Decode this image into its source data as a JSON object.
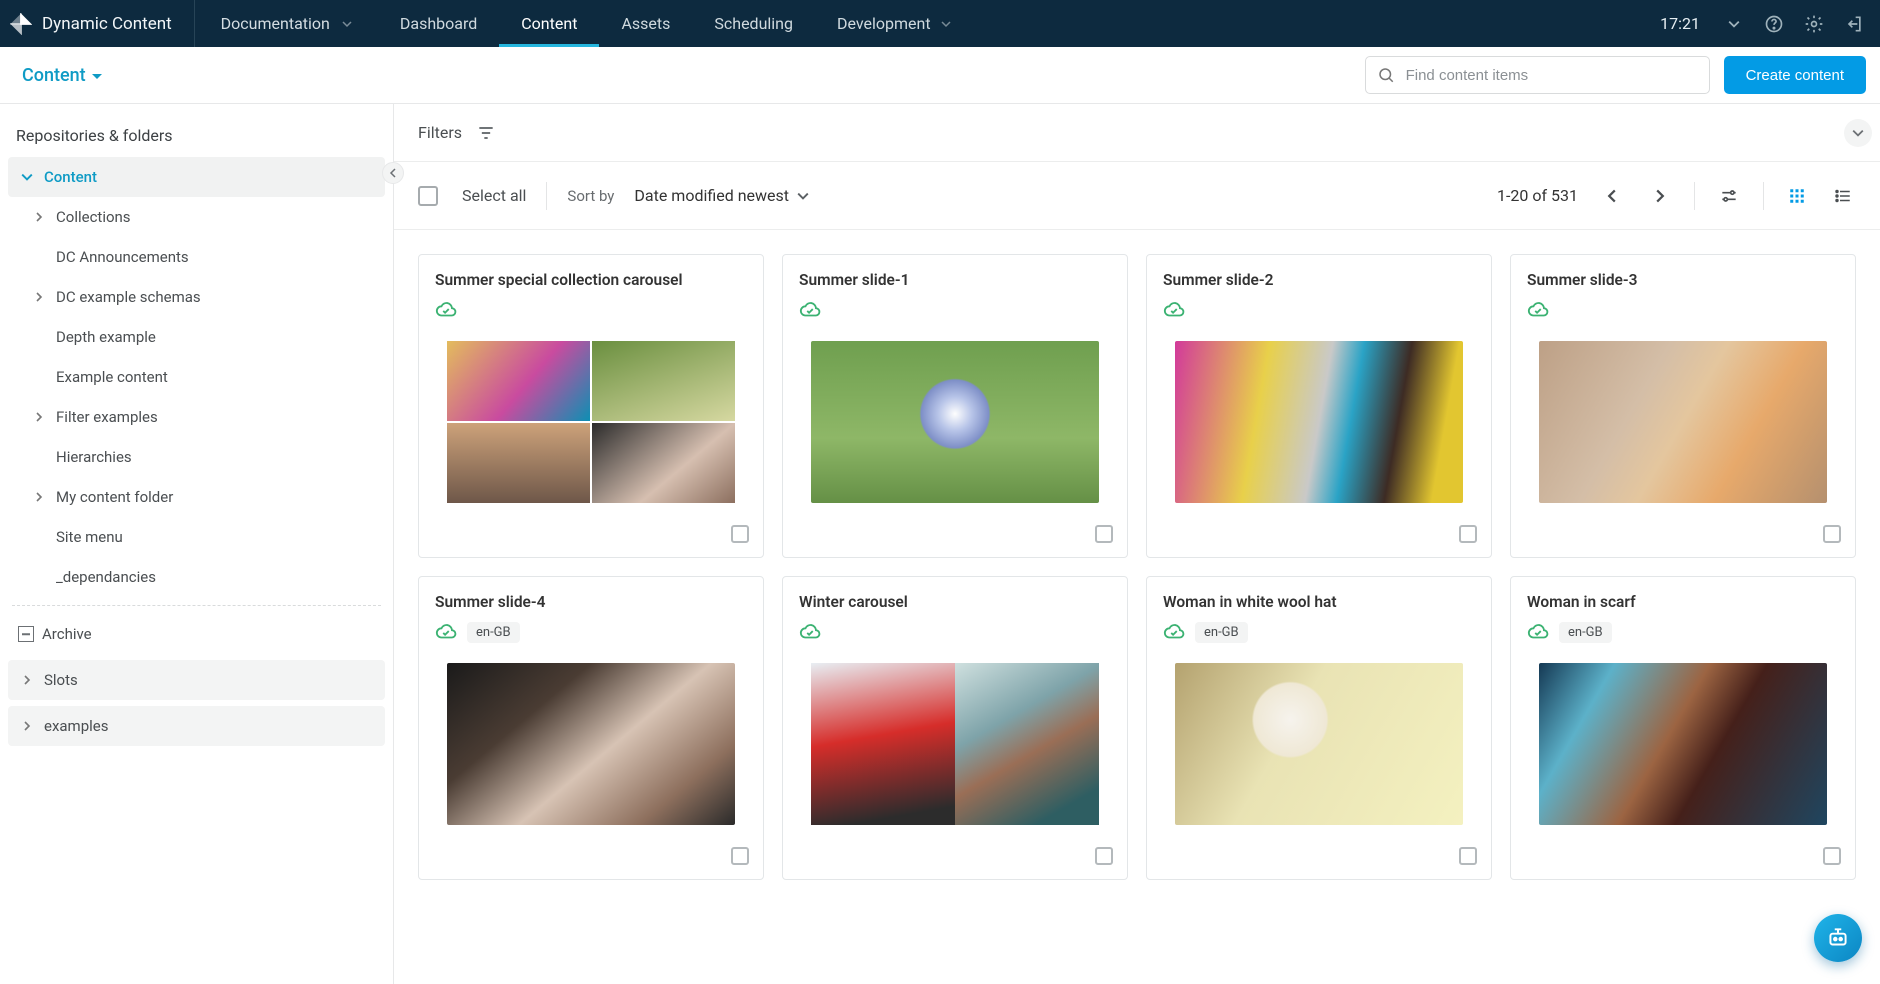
{
  "brand": {
    "name": "Dynamic Content"
  },
  "topnav": {
    "documentation": "Documentation",
    "items": [
      "Dashboard",
      "Content",
      "Assets",
      "Scheduling",
      "Development"
    ],
    "active": "Content",
    "time": "17:21"
  },
  "subbar": {
    "title": "Content",
    "search_placeholder": "Find content items",
    "create_label": "Create content"
  },
  "sidebar": {
    "title": "Repositories & folders",
    "root_label": "Content",
    "children": [
      {
        "label": "Collections",
        "expandable": true
      },
      {
        "label": "DC Announcements",
        "expandable": false
      },
      {
        "label": "DC example schemas",
        "expandable": true
      },
      {
        "label": "Depth example",
        "expandable": false
      },
      {
        "label": "Example content",
        "expandable": false
      },
      {
        "label": "Filter examples",
        "expandable": true
      },
      {
        "label": "Hierarchies",
        "expandable": false
      },
      {
        "label": "My content folder",
        "expandable": true
      },
      {
        "label": "Site menu",
        "expandable": false
      },
      {
        "label": "_dependancies",
        "expandable": false
      }
    ],
    "archive": "Archive",
    "repos": [
      {
        "label": "Slots"
      },
      {
        "label": "examples"
      }
    ]
  },
  "main": {
    "filters_label": "Filters",
    "select_all": "Select all",
    "sort_by_label": "Sort by",
    "sort_by_value": "Date modified newest",
    "pagination": "1-20 of 531",
    "cards": [
      {
        "title": "Summer special collection carousel",
        "locale": null,
        "thumb": "t1"
      },
      {
        "title": "Summer slide-1",
        "locale": null,
        "thumb": "t2"
      },
      {
        "title": "Summer slide-2",
        "locale": null,
        "thumb": "t3"
      },
      {
        "title": "Summer slide-3",
        "locale": null,
        "thumb": "t4"
      },
      {
        "title": "Summer slide-4",
        "locale": "en-GB",
        "thumb": "t5"
      },
      {
        "title": "Winter carousel",
        "locale": null,
        "thumb": "t6"
      },
      {
        "title": "Woman in white wool hat",
        "locale": "en-GB",
        "thumb": "t7"
      },
      {
        "title": "Woman in scarf",
        "locale": "en-GB",
        "thumb": "t8"
      }
    ]
  }
}
